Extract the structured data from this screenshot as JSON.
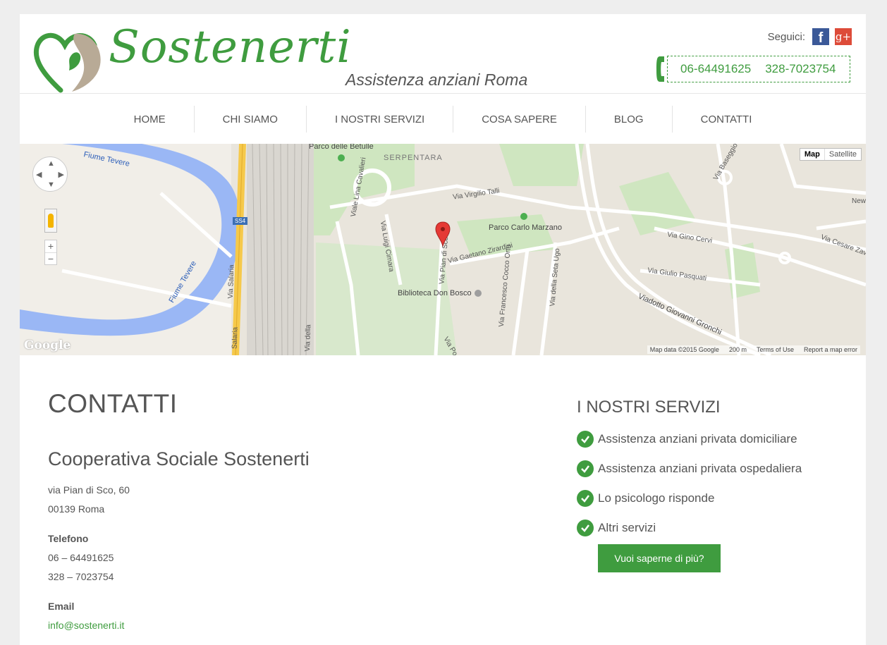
{
  "header": {
    "logo_text": "Sostenerti",
    "tagline": "Assistenza anziani Roma",
    "social_label": "Seguici:",
    "facebook_glyph": "f",
    "gplus_glyph": "g+",
    "phone1": "06-64491625",
    "phone2": "328-7023754"
  },
  "nav": {
    "items": [
      "HOME",
      "CHI SIAMO",
      "I NOSTRI SERVIZI",
      "COSA SAPERE",
      "BLOG",
      "CONTATTI"
    ]
  },
  "map": {
    "type_map": "Map",
    "type_satellite": "Satellite",
    "google_logo": "Google",
    "map_data": "Map data ©2015 Google",
    "scale": "200 m",
    "terms": "Terms of Use",
    "report": "Report a map error",
    "labels": {
      "fiume1": "Fiume Tevere",
      "fiume2": "Fiume Tevere",
      "parco_betulle": "Parco delle Betulle",
      "serpentara": "SERPENTARA",
      "lina_cavalieri": "Viale Lina Cavalieri",
      "virgilio_talli": "Via Virgilio Talli",
      "parco_marzano": "Parco Carlo Marzano",
      "luigi_cimara": "Via Luigi Cimara",
      "pian_di_sco": "Via Pian di Sco",
      "zirardini": "Via Gaetano Zirardini",
      "biblioteca": "Biblioteca Don Bosco",
      "cocco_ortu": "Via Francesco Cocco Ortu",
      "seta_ugo": "Via della Seta Ugo",
      "gino_cervi": "Via Gino Cervi",
      "giulio_pasquati": "Via Giulio Pasquati",
      "viadotto": "Viadotto Giovanni Gronchi",
      "cesare_zavat": "Via Cesare Zavat",
      "salaria": "Via Salaria",
      "salaria2": "Salaria",
      "via_della": "Via della",
      "via_po": "Via Po",
      "basseggio": "Via Baseggio",
      "new": "New",
      "ss4": "SS4"
    }
  },
  "contact": {
    "heading": "CONTATTI",
    "org": "Cooperativa Sociale Sostenerti",
    "address1": "via Pian di Sco, 60",
    "address2": "00139 Roma",
    "phone_label": "Telefono",
    "phone1": "06 – 64491625",
    "phone2": "328 – 7023754",
    "email_label": "Email",
    "email": "info@sostenerti.it"
  },
  "services": {
    "heading": "I NOSTRI SERVIZI",
    "items": [
      "Assistenza anziani privata domiciliare",
      "Assistenza anziani privata ospedaliera",
      "Lo psicologo risponde",
      "Altri servizi"
    ],
    "button": "Vuoi saperne di più?"
  },
  "colors": {
    "accent": "#3f9c3f",
    "text": "#555555",
    "background": "#eeeeee"
  }
}
